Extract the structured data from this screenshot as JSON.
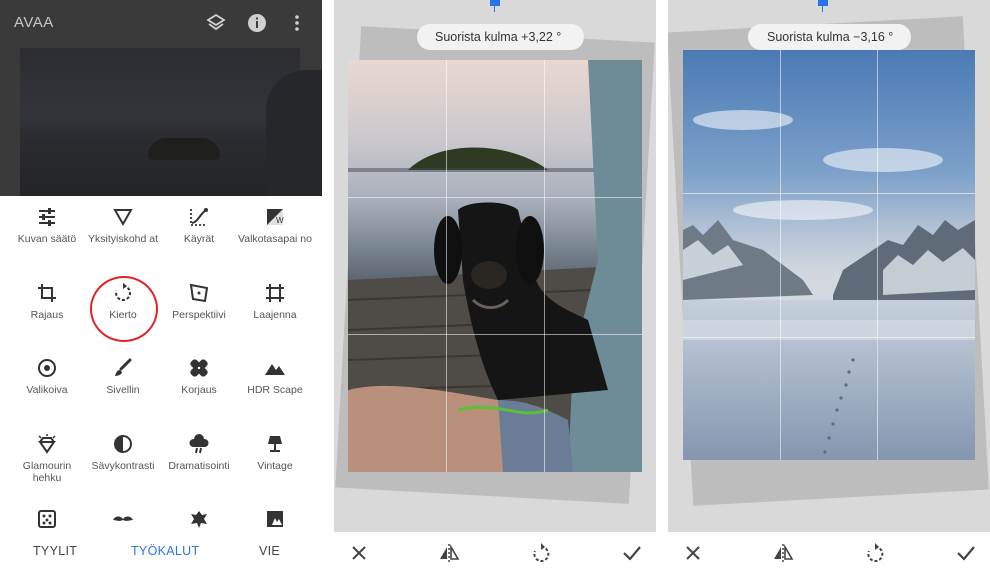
{
  "panel1": {
    "app_title": "AVAA",
    "top_icons": [
      "layers-icon",
      "info-icon",
      "more-vert-icon"
    ],
    "tools": [
      {
        "label": "Kuvan säätö",
        "icon": "tune-sliders-icon"
      },
      {
        "label": "Yksityiskohd at",
        "icon": "details-triangle-icon"
      },
      {
        "label": "Käyrät",
        "icon": "curves-icon"
      },
      {
        "label": "Valkotasapai no",
        "icon": "white-balance-icon"
      },
      {
        "label": "Rajaus",
        "icon": "crop-icon"
      },
      {
        "label": "Kierto",
        "icon": "rotate-icon"
      },
      {
        "label": "Perspektiivi",
        "icon": "perspective-icon"
      },
      {
        "label": "Laajenna",
        "icon": "expand-icon"
      },
      {
        "label": "Valikoiva",
        "icon": "selective-icon"
      },
      {
        "label": "Sivellin",
        "icon": "brush-icon"
      },
      {
        "label": "Korjaus",
        "icon": "healing-icon"
      },
      {
        "label": "HDR Scape",
        "icon": "hdr-mountains-icon"
      },
      {
        "label": "Glamourin hehku",
        "icon": "glamour-glow-icon"
      },
      {
        "label": "Sävykontrasti",
        "icon": "tonal-contrast-icon"
      },
      {
        "label": "Dramatisointi",
        "icon": "drama-cloud-icon"
      },
      {
        "label": "Vintage",
        "icon": "vintage-lamp-icon"
      },
      {
        "label": "",
        "icon": "grainy-film-icon"
      },
      {
        "label": "",
        "icon": "mustache-icon"
      },
      {
        "label": "",
        "icon": "grunge-icon"
      },
      {
        "label": "",
        "icon": "black-white-icon"
      }
    ],
    "nav": {
      "styles": "TYYLIT",
      "tools": "TYÖKALUT",
      "export": "VIE"
    },
    "accent": "#2a73e8",
    "highlight_color": "#e32329"
  },
  "panel2": {
    "angle_label": "Suorista kulma +3,22 °",
    "scene": "dachshund-on-dock-photo",
    "toolbar": [
      "close-icon",
      "mirror-icon",
      "rotate-icon",
      "check-icon"
    ]
  },
  "panel3": {
    "angle_label": "Suorista kulma −3,16 °",
    "scene": "snowy-field-photo",
    "toolbar": [
      "close-icon",
      "mirror-icon",
      "rotate-icon",
      "check-icon"
    ]
  }
}
